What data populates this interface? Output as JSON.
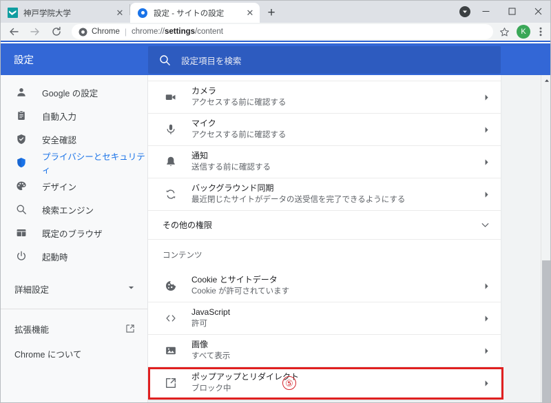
{
  "window": {
    "minimize_label": "−",
    "maximize_label": "▢",
    "close_label": "✕"
  },
  "tabs": [
    {
      "title": "神戸学院大学",
      "favicon": "kobe-gakuin-logo-icon",
      "active": false,
      "close_label": "✕"
    },
    {
      "title": "設定 - サイトの設定",
      "favicon": "settings-gear-icon",
      "active": true,
      "close_label": "✕"
    }
  ],
  "newtab_label": "+",
  "toolbar": {
    "back_icon": "arrow-left-icon",
    "forward_icon": "arrow-right-icon",
    "reload_icon": "reload-icon",
    "omnibox": {
      "security_icon": "chrome-page-icon",
      "scheme_label": "Chrome",
      "separator": "|",
      "url_prefix": "chrome://",
      "url_bold": "settings",
      "url_suffix": "/content"
    },
    "bookmark_icon": "star-outline-icon",
    "avatar_letter": "K",
    "menu_icon": "three-dot-menu-icon"
  },
  "settings_header": {
    "title": "設定",
    "search_icon": "search-icon",
    "search_placeholder": "設定項目を検索"
  },
  "sidebar": {
    "items": [
      {
        "label": "Google の設定",
        "icon": "person-icon",
        "active": false
      },
      {
        "label": "自動入力",
        "icon": "clipboard-icon",
        "active": false
      },
      {
        "label": "安全確認",
        "icon": "shield-check-icon",
        "active": false
      },
      {
        "label": "プライバシーとセキュリティ",
        "icon": "shield-icon",
        "active": true
      },
      {
        "label": "デザイン",
        "icon": "palette-icon",
        "active": false
      },
      {
        "label": "検索エンジン",
        "icon": "search-icon",
        "active": false
      },
      {
        "label": "既定のブラウザ",
        "icon": "browser-window-icon",
        "active": false
      },
      {
        "label": "起動時",
        "icon": "power-icon",
        "active": false
      }
    ],
    "advanced": {
      "label": "詳細設定",
      "icon": "chevron-down-icon"
    },
    "footer": [
      {
        "label": "拡張機能",
        "icon": "open-in-new-icon"
      },
      {
        "label": "Chrome について",
        "icon": ""
      }
    ]
  },
  "content": {
    "permission_rows": [
      {
        "title": "カメラ",
        "subtitle": "アクセスする前に確認する",
        "icon": "video-camera-icon",
        "arrow": "chevron-right-icon"
      },
      {
        "title": "マイク",
        "subtitle": "アクセスする前に確認する",
        "icon": "microphone-icon",
        "arrow": "chevron-right-icon"
      },
      {
        "title": "通知",
        "subtitle": "送信する前に確認する",
        "icon": "bell-icon",
        "arrow": "chevron-right-icon"
      },
      {
        "title": "バックグラウンド同期",
        "subtitle": "最近閉じたサイトがデータの送受信を完了できるようにする",
        "icon": "sync-icon",
        "arrow": "chevron-right-icon"
      }
    ],
    "more_permissions": {
      "label": "その他の権限",
      "icon": "chevron-down-icon"
    },
    "content_section_title": "コンテンツ",
    "content_rows": [
      {
        "title": "Cookie とサイトデータ",
        "subtitle": "Cookie が許可されています",
        "icon": "cookie-icon",
        "arrow": "chevron-right-icon",
        "highlighted": false
      },
      {
        "title": "JavaScript",
        "subtitle": "許可",
        "icon": "code-brackets-icon",
        "arrow": "chevron-right-icon",
        "highlighted": false
      },
      {
        "title": "画像",
        "subtitle": "すべて表示",
        "icon": "image-icon",
        "arrow": "chevron-right-icon",
        "highlighted": false
      },
      {
        "title": "ポップアップとリダイレクト",
        "subtitle": "ブロック中",
        "icon": "open-in-new-icon",
        "arrow": "chevron-right-icon",
        "highlighted": true
      }
    ]
  },
  "annotation": {
    "step_number": "⑤",
    "highlight_color": "#e02020"
  },
  "scrollbar": {
    "up_arrow_icon": "triangle-up-icon"
  }
}
